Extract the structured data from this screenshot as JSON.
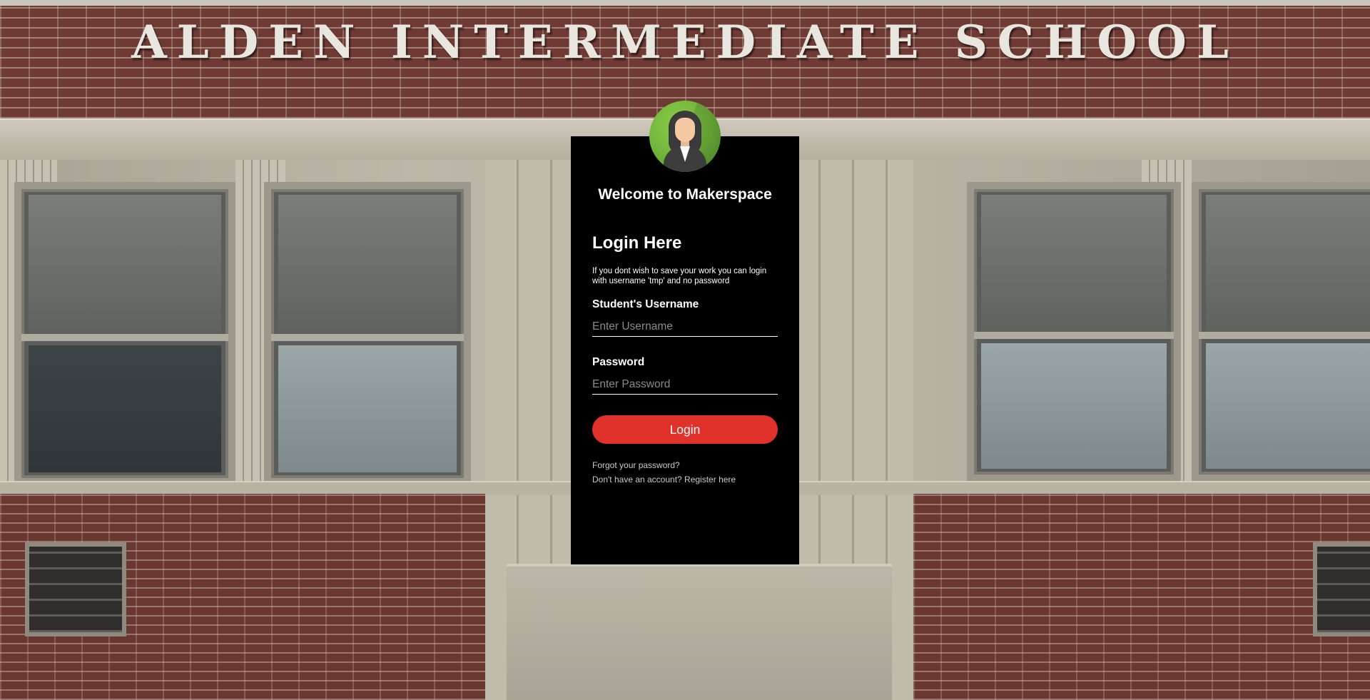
{
  "background": {
    "school_name": "ALDEN INTERMEDIATE SCHOOL"
  },
  "login": {
    "avatar_icon": "user-avatar-icon",
    "welcome": "Welcome to Makerspace",
    "heading": "Login Here",
    "note": "If you dont wish to save your work you can login with username 'tmp' and no password",
    "username_label": "Student's Username",
    "username_placeholder": "Enter Username",
    "username_value": "",
    "password_label": "Password",
    "password_placeholder": "Enter Password",
    "password_value": "",
    "button_label": "Login",
    "forgot_link": "Forgot your password?",
    "register_link": "Don't have an account? Register here"
  },
  "colors": {
    "card_background": "#000000",
    "button": "#e0312a",
    "avatar_circle": "#6fb33a"
  }
}
